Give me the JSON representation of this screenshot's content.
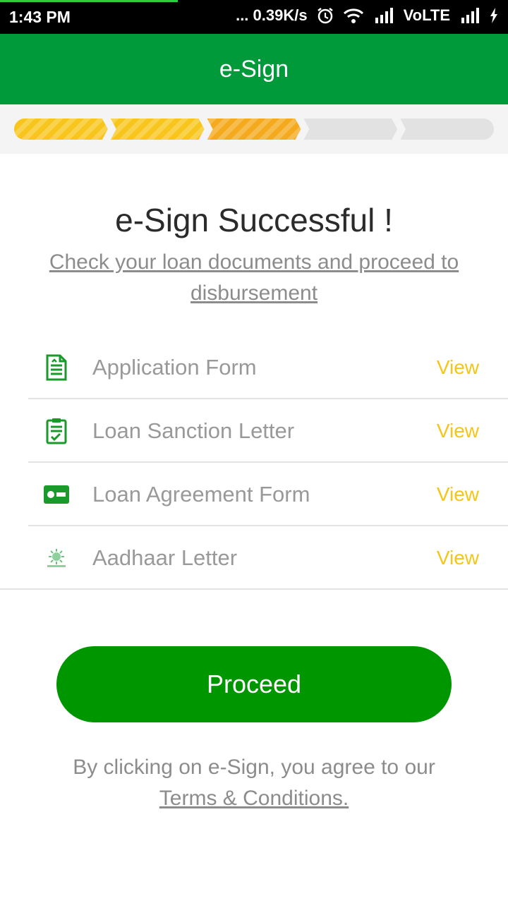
{
  "status_bar": {
    "time": "1:43 PM",
    "net_speed": "... 0.39K/s",
    "volte": "VoLTE",
    "icons": [
      "alarm-icon",
      "wifi-icon",
      "signal-icon",
      "signal-icon",
      "charging-icon"
    ]
  },
  "app_bar": {
    "title": "e-Sign"
  },
  "progress": {
    "total_steps": 5,
    "completed_steps": 3,
    "colors": {
      "done": "#f7c51c",
      "current": "#f5a91c",
      "pending": "#e2e2e2"
    }
  },
  "main": {
    "headline": "e-Sign Successful !",
    "subtitle": "Check your loan documents and proceed to disbursement"
  },
  "documents": [
    {
      "label": "Application Form",
      "action": "View",
      "icon": "application-form-icon"
    },
    {
      "label": "Loan Sanction Letter",
      "action": "View",
      "icon": "sanction-letter-icon"
    },
    {
      "label": "Loan Agreement Form",
      "action": "View",
      "icon": "id-card-icon"
    },
    {
      "label": "Aadhaar Letter",
      "action": "View",
      "icon": "aadhaar-logo-icon"
    }
  ],
  "proceed_button": {
    "label": "Proceed"
  },
  "terms": {
    "text": "By clicking on e-Sign, you agree to our",
    "link": "Terms & Conditions."
  },
  "colors": {
    "brand_green": "#009a3a",
    "button_green": "#009600",
    "view_yellow": "#f5c518"
  }
}
